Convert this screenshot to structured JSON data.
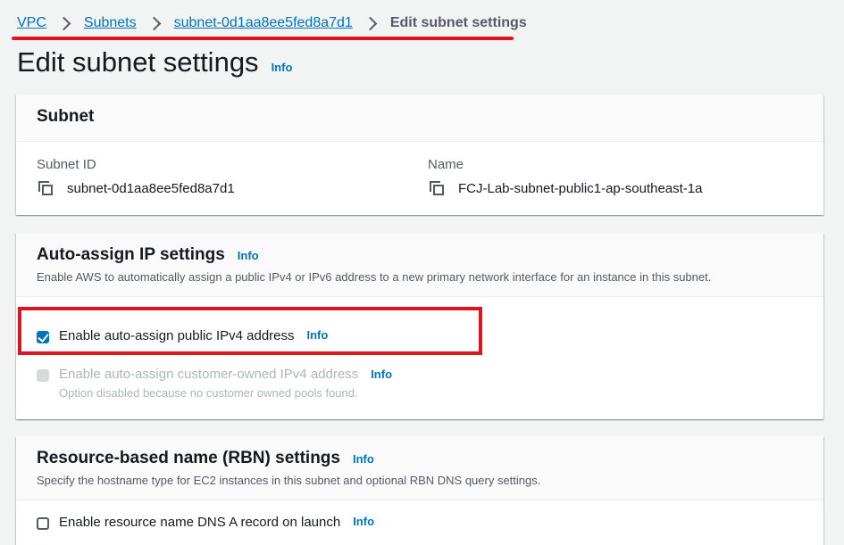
{
  "breadcrumb": {
    "items": [
      "VPC",
      "Subnets",
      "subnet-0d1aa8ee5fed8a7d1"
    ],
    "current": "Edit subnet settings"
  },
  "page": {
    "title": "Edit subnet settings",
    "info": "Info"
  },
  "subnet_panel": {
    "title": "Subnet",
    "subnet_id_label": "Subnet ID",
    "subnet_id_value": "subnet-0d1aa8ee5fed8a7d1",
    "name_label": "Name",
    "name_value": "FCJ-Lab-subnet-public1-ap-southeast-1a"
  },
  "ip_panel": {
    "title": "Auto-assign IP settings",
    "info": "Info",
    "description": "Enable AWS to automatically assign a public IPv4 or IPv6 address to a new primary network interface for an instance in this subnet.",
    "options": [
      {
        "label": "Enable auto-assign public IPv4 address",
        "info": "Info",
        "checked": true,
        "disabled": false
      },
      {
        "label": "Enable auto-assign customer-owned IPv4 address",
        "info": "Info",
        "checked": false,
        "disabled": true,
        "note": "Option disabled because no customer owned pools found."
      }
    ]
  },
  "rbn_panel": {
    "title": "Resource-based name (RBN) settings",
    "info": "Info",
    "description": "Specify the hostname type for EC2 instances in this subnet and optional RBN DNS query settings.",
    "options": [
      {
        "label": "Enable resource name DNS A record on launch",
        "info": "Info",
        "checked": false
      }
    ]
  },
  "colors": {
    "link": "#0073bb",
    "annotation": "#e0141e",
    "background": "#f2f3f3"
  }
}
